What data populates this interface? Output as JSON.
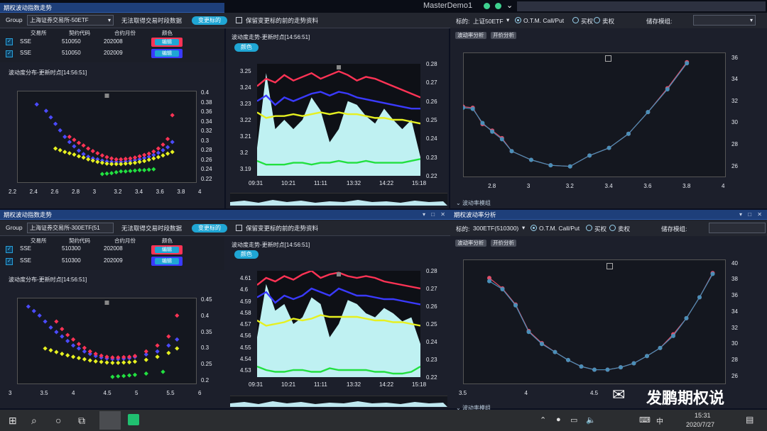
{
  "window": {
    "title": "MasterDemo1"
  },
  "panels": {
    "top_left_title": "期权波动指数走势",
    "bottom_left_title": "期权波动指数走势",
    "bottom_right_title": "期权波动率分析"
  },
  "toolbar_top": {
    "group_label": "Group",
    "group_value": "上海证券交易所-50ETF",
    "msg": "无法取得交易时段数据",
    "change_btn": "变更标的",
    "keep_label": "保留变更标的前的走势资料"
  },
  "toolbar_bottom": {
    "group_label": "Group",
    "group_value": "上海证券交易所-300ETF(51",
    "msg": "无法取得交易时段数据",
    "change_btn": "变更标的",
    "keep_label": "保留变更标的前的走势资料"
  },
  "table_headers": [
    "交易所",
    "契约代码",
    "合约月份",
    "颜色"
  ],
  "table_top": [
    {
      "ex": "SSE",
      "code": "510050",
      "month": "202008",
      "edit": "编辑"
    },
    {
      "ex": "SSE",
      "code": "510050",
      "month": "202009",
      "edit": "编辑"
    }
  ],
  "table_bottom": [
    {
      "ex": "SSE",
      "code": "510300",
      "month": "202008",
      "edit": "编辑"
    },
    {
      "ex": "SSE",
      "code": "510300",
      "month": "202009",
      "edit": "编辑"
    }
  ],
  "dist_title": "波动度分布-更新时点[14:56:51]",
  "trend_title": "波动度走势-更新时点[14:56:51]",
  "color_btn": "颜色",
  "right_top": {
    "underlying_label": "标的:",
    "underlying": "上证50ETF",
    "otm": "O.T.M. Call/Put",
    "call": "买权",
    "put": "卖权",
    "model_label": "储存模组:",
    "tab1": "波动率分析",
    "tab2": "开价分析",
    "footer": "波动率模组"
  },
  "right_bottom": {
    "underlying_label": "标的:",
    "underlying": "300ETF(510300)",
    "otm": "O.T.M. Call/Put",
    "call": "买权",
    "put": "卖权",
    "model_label": "储存模组:",
    "tab1": "波动率分析",
    "tab2": "开价分析",
    "footer": "波动率模组"
  },
  "taskbar": {
    "time": "15:31",
    "date": "2020/7/27",
    "lang": "中",
    "watermark": "发鹏期权说"
  },
  "chart_data": [
    {
      "type": "scatter",
      "title": "波动度分布-更新时点[14:56:51]",
      "x_ticks": [
        "2.2",
        "2.4",
        "2.6",
        "2.8",
        "3",
        "3.2",
        "3.4",
        "3.6",
        "3.8",
        "4"
      ],
      "y_ticks": [
        "0.4",
        "0.38",
        "0.36",
        "0.34",
        "0.32",
        "0.3",
        "0.28",
        "0.26",
        "0.24",
        "0.22"
      ],
      "xlim": [
        2.2,
        4
      ],
      "ylim": [
        0.21,
        0.41
      ],
      "series": [
        {
          "color": "#4b4bff",
          "x": [
            2.35,
            2.45,
            2.5,
            2.55,
            2.6,
            2.65,
            2.7,
            2.75,
            2.8,
            2.85,
            2.9,
            2.95,
            3.0,
            3.05,
            3.1,
            3.15,
            3.2,
            3.25,
            3.3,
            3.35,
            3.4,
            3.45,
            3.5,
            3.55,
            3.6,
            3.65,
            3.7,
            3.75,
            3.8
          ],
          "y": [
            0.385,
            0.37,
            0.355,
            0.34,
            0.325,
            0.31,
            0.298,
            0.288,
            0.278,
            0.27,
            0.264,
            0.26,
            0.258,
            0.255,
            0.253,
            0.252,
            0.252,
            0.252,
            0.253,
            0.254,
            0.256,
            0.258,
            0.261,
            0.264,
            0.268,
            0.273,
            0.279,
            0.286,
            0.298
          ]
        },
        {
          "color": "#ff3355",
          "x": [
            2.7,
            2.75,
            2.8,
            2.85,
            2.9,
            2.95,
            3.0,
            3.05,
            3.1,
            3.15,
            3.2,
            3.25,
            3.3,
            3.35,
            3.4,
            3.45,
            3.5,
            3.55,
            3.6,
            3.65,
            3.7,
            3.75,
            3.8
          ],
          "y": [
            0.31,
            0.303,
            0.296,
            0.29,
            0.283,
            0.277,
            0.272,
            0.267,
            0.263,
            0.26,
            0.258,
            0.258,
            0.259,
            0.26,
            0.262,
            0.265,
            0.268,
            0.271,
            0.276,
            0.283,
            0.292,
            0.305,
            0.36
          ]
        },
        {
          "color": "#e6f020",
          "x": [
            2.55,
            2.6,
            2.65,
            2.7,
            2.75,
            2.8,
            2.85,
            2.9,
            2.95,
            3.0,
            3.05,
            3.1,
            3.15,
            3.2,
            3.25,
            3.3,
            3.35,
            3.4,
            3.45,
            3.5,
            3.55,
            3.6,
            3.65,
            3.7,
            3.75,
            3.8
          ],
          "y": [
            0.283,
            0.279,
            0.275,
            0.272,
            0.269,
            0.265,
            0.262,
            0.258,
            0.255,
            0.252,
            0.25,
            0.248,
            0.247,
            0.247,
            0.247,
            0.248,
            0.249,
            0.25,
            0.252,
            0.254,
            0.257,
            0.26,
            0.263,
            0.267,
            0.271,
            0.275
          ]
        },
        {
          "color": "#22e040",
          "x": [
            3.05,
            3.1,
            3.15,
            3.2,
            3.25,
            3.3,
            3.35,
            3.4,
            3.45,
            3.5,
            3.55,
            3.6
          ],
          "y": [
            0.224,
            0.225,
            0.226,
            0.228,
            0.23,
            0.23,
            0.231,
            0.232,
            0.233,
            0.233,
            0.234,
            0.235
          ]
        }
      ]
    },
    {
      "type": "line",
      "title": "波动度走势-更新时点[14:56:51]",
      "x_ticks": [
        "09:31",
        "10:21",
        "11:11",
        "13:32",
        "14:22",
        "15:18"
      ],
      "y_left_ticks": [
        "3.25",
        "3.24",
        "3.23",
        "3.22",
        "3.21",
        "3.2",
        "3.19"
      ],
      "y_right_ticks": [
        "0.28",
        "0.27",
        "0.26",
        "0.25",
        "0.24",
        "0.23",
        "0.22"
      ],
      "series": [
        {
          "color": "#ff3355",
          "values": [
            0.268,
            0.272,
            0.27,
            0.274,
            0.271,
            0.273,
            0.275,
            0.272,
            0.274,
            0.276,
            0.274,
            0.271,
            0.273,
            0.272,
            0.27,
            0.268,
            0.266,
            0.264,
            0.262
          ]
        },
        {
          "color": "#3a3aff",
          "values": [
            0.26,
            0.263,
            0.258,
            0.262,
            0.26,
            0.262,
            0.264,
            0.265,
            0.263,
            0.265,
            0.264,
            0.262,
            0.261,
            0.26,
            0.259,
            0.258,
            0.257,
            0.256,
            0.256
          ]
        },
        {
          "color": "#e6f020",
          "values": [
            0.254,
            0.251,
            0.252,
            0.252,
            0.253,
            0.252,
            0.253,
            0.254,
            0.253,
            0.254,
            0.253,
            0.253,
            0.252,
            0.251,
            0.251,
            0.25,
            0.25,
            0.249,
            0.248
          ]
        },
        {
          "color": "#22e040",
          "values": [
            0.228,
            0.226,
            0.226,
            0.226,
            0.227,
            0.227,
            0.226,
            0.227,
            0.227,
            0.228,
            0.227,
            0.227,
            0.228,
            0.227,
            0.227,
            0.227,
            0.227,
            0.228,
            0.229
          ]
        }
      ],
      "area_price": [
        3.205,
        3.245,
        3.215,
        3.22,
        3.215,
        3.22,
        3.232,
        3.225,
        3.208,
        3.215,
        3.23,
        3.228,
        3.222,
        3.218,
        3.226,
        3.22,
        3.215,
        3.22,
        3.2
      ]
    },
    {
      "type": "line",
      "title": "",
      "x_ticks": [
        "2.8",
        "3",
        "3.2",
        "3.4",
        "3.6",
        "3.8",
        "4"
      ],
      "y_ticks": [
        "36",
        "34",
        "32",
        "30",
        "28",
        "26"
      ],
      "xlim": [
        2.65,
        4
      ],
      "ylim": [
        25,
        36.5
      ],
      "series": [
        {
          "color": "#4a8fb8",
          "x": [
            2.65,
            2.7,
            2.75,
            2.8,
            2.85,
            2.9,
            3.0,
            3.1,
            3.2,
            3.3,
            3.4,
            3.5,
            3.6,
            3.7,
            3.8
          ],
          "y": [
            31.4,
            31.3,
            30.0,
            29.2,
            28.5,
            27.4,
            26.6,
            26.1,
            26.0,
            27.0,
            27.7,
            29.0,
            31.0,
            33.1,
            35.5
          ]
        },
        {
          "color": "#e0506a",
          "x": [
            2.65,
            2.7,
            2.75,
            2.8,
            2.85,
            2.9,
            3.0,
            3.1,
            3.2,
            3.3,
            3.4,
            3.5,
            3.6,
            3.7,
            3.8
          ],
          "y": [
            31.5,
            31.4,
            29.9,
            29.3,
            28.6,
            27.4,
            26.6,
            26.1,
            26.0,
            27.0,
            27.7,
            29.0,
            31.0,
            33.2,
            35.6
          ]
        }
      ]
    },
    {
      "type": "scatter",
      "title": "波动度分布-更新时点[14:56:51]",
      "x_ticks": [
        "3",
        "3.5",
        "4",
        "4.5",
        "5",
        "5.5",
        "6"
      ],
      "y_ticks": [
        "0.45",
        "0.4",
        "0.35",
        "0.3",
        "0.25",
        "0.2"
      ],
      "xlim": [
        3,
        6
      ],
      "ylim": [
        0.19,
        0.46
      ],
      "series": [
        {
          "color": "#4b4bff",
          "x": [
            3.1,
            3.2,
            3.3,
            3.4,
            3.5,
            3.6,
            3.7,
            3.8,
            3.9,
            4.0,
            4.1,
            4.2,
            4.3,
            4.4,
            4.5,
            4.6,
            4.7,
            4.8,
            4.9,
            5.0,
            5.2,
            5.4,
            5.6,
            5.75
          ],
          "y": [
            0.44,
            0.425,
            0.41,
            0.39,
            0.37,
            0.355,
            0.34,
            0.325,
            0.31,
            0.3,
            0.29,
            0.282,
            0.275,
            0.27,
            0.267,
            0.265,
            0.265,
            0.266,
            0.268,
            0.272,
            0.28,
            0.29,
            0.31,
            0.33
          ]
        },
        {
          "color": "#ff3355",
          "x": [
            3.6,
            3.7,
            3.8,
            3.9,
            4.0,
            4.1,
            4.2,
            4.3,
            4.4,
            4.5,
            4.6,
            4.7,
            4.8,
            4.9,
            5.0,
            5.2,
            5.4,
            5.6,
            5.75
          ],
          "y": [
            0.39,
            0.365,
            0.345,
            0.33,
            0.315,
            0.302,
            0.29,
            0.282,
            0.276,
            0.272,
            0.27,
            0.27,
            0.271,
            0.272,
            0.275,
            0.29,
            0.31,
            0.34,
            0.41
          ]
        },
        {
          "color": "#e6f020",
          "x": [
            3.4,
            3.5,
            3.6,
            3.7,
            3.8,
            3.9,
            4.0,
            4.1,
            4.2,
            4.3,
            4.4,
            4.5,
            4.6,
            4.7,
            4.8,
            4.9,
            5.0,
            5.2,
            5.4,
            5.6,
            5.75
          ],
          "y": [
            0.3,
            0.294,
            0.288,
            0.282,
            0.277,
            0.272,
            0.268,
            0.264,
            0.26,
            0.257,
            0.255,
            0.253,
            0.252,
            0.252,
            0.253,
            0.254,
            0.256,
            0.262,
            0.272,
            0.285,
            0.3
          ]
        },
        {
          "color": "#22e040",
          "x": [
            4.6,
            4.7,
            4.8,
            4.9,
            5.0,
            5.2,
            5.5
          ],
          "y": [
            0.205,
            0.207,
            0.208,
            0.21,
            0.212,
            0.216,
            0.222
          ]
        }
      ]
    },
    {
      "type": "line",
      "title": "波动度走势-更新时点[14:56:51]",
      "x_ticks": [
        "09:31",
        "10:21",
        "11:11",
        "13:32",
        "14:22",
        "15:18"
      ],
      "y_left_ticks": [
        "4.61",
        "4.6",
        "4.59",
        "4.58",
        "4.57",
        "4.56",
        "4.55",
        "4.54",
        "4.53"
      ],
      "y_right_ticks": [
        "0.28",
        "0.27",
        "0.26",
        "0.25",
        "0.24",
        "0.23",
        "0.22"
      ],
      "series": [
        {
          "color": "#ff3355",
          "values": [
            0.272,
            0.276,
            0.274,
            0.277,
            0.275,
            0.278,
            0.28,
            0.276,
            0.278,
            0.279,
            0.277,
            0.276,
            0.277,
            0.276,
            0.274,
            0.273,
            0.272,
            0.271,
            0.27
          ]
        },
        {
          "color": "#3a3aff",
          "values": [
            0.265,
            0.268,
            0.262,
            0.266,
            0.264,
            0.266,
            0.27,
            0.268,
            0.266,
            0.27,
            0.268,
            0.266,
            0.266,
            0.265,
            0.264,
            0.264,
            0.263,
            0.262,
            0.261
          ]
        },
        {
          "color": "#e6f020",
          "values": [
            0.252,
            0.249,
            0.25,
            0.251,
            0.253,
            0.252,
            0.253,
            0.255,
            0.254,
            0.254,
            0.254,
            0.254,
            0.253,
            0.252,
            0.252,
            0.251,
            0.251,
            0.25,
            0.249
          ]
        },
        {
          "color": "#22e040",
          "values": [
            0.226,
            0.224,
            0.223,
            0.223,
            0.224,
            0.224,
            0.223,
            0.223,
            0.225,
            0.224,
            0.224,
            0.224,
            0.224,
            0.223,
            0.223,
            0.222,
            0.222,
            0.223,
            0.226
          ]
        }
      ],
      "area_price": [
        4.56,
        4.6,
        4.58,
        4.585,
        4.57,
        4.575,
        4.59,
        4.585,
        4.56,
        4.57,
        4.588,
        4.585,
        4.578,
        4.575,
        4.582,
        4.578,
        4.572,
        4.575,
        4.555
      ]
    },
    {
      "type": "line",
      "title": "",
      "x_ticks": [
        "3.5",
        "4",
        "4.5",
        "5"
      ],
      "y_ticks": [
        "40",
        "38",
        "36",
        "34",
        "32",
        "30",
        "28",
        "26"
      ],
      "xlim": [
        3.5,
        5.5
      ],
      "ylim": [
        25,
        40.5
      ],
      "series": [
        {
          "color": "#4a8fb8",
          "x": [
            3.7,
            3.8,
            3.9,
            4.0,
            4.1,
            4.2,
            4.3,
            4.4,
            4.5,
            4.6,
            4.7,
            4.8,
            4.9,
            5.0,
            5.1,
            5.2,
            5.3,
            5.4
          ],
          "y": [
            37.8,
            36.8,
            34.8,
            31.5,
            30.0,
            29.0,
            28.0,
            27.2,
            26.8,
            26.8,
            27.1,
            27.6,
            28.5,
            29.5,
            31.0,
            33.2,
            35.8,
            38.7
          ]
        },
        {
          "color": "#e0506a",
          "x": [
            3.7,
            3.8,
            3.9,
            4.0,
            4.1,
            4.2,
            4.3,
            4.4,
            4.5,
            4.6,
            4.7,
            4.8,
            4.9,
            5.0,
            5.1,
            5.2,
            5.3,
            5.4
          ],
          "y": [
            38.2,
            36.9,
            34.9,
            31.6,
            30.1,
            29.0,
            28.0,
            27.2,
            26.8,
            26.8,
            27.1,
            27.6,
            28.5,
            29.5,
            31.2,
            33.2,
            35.8,
            38.8
          ]
        }
      ]
    }
  ]
}
